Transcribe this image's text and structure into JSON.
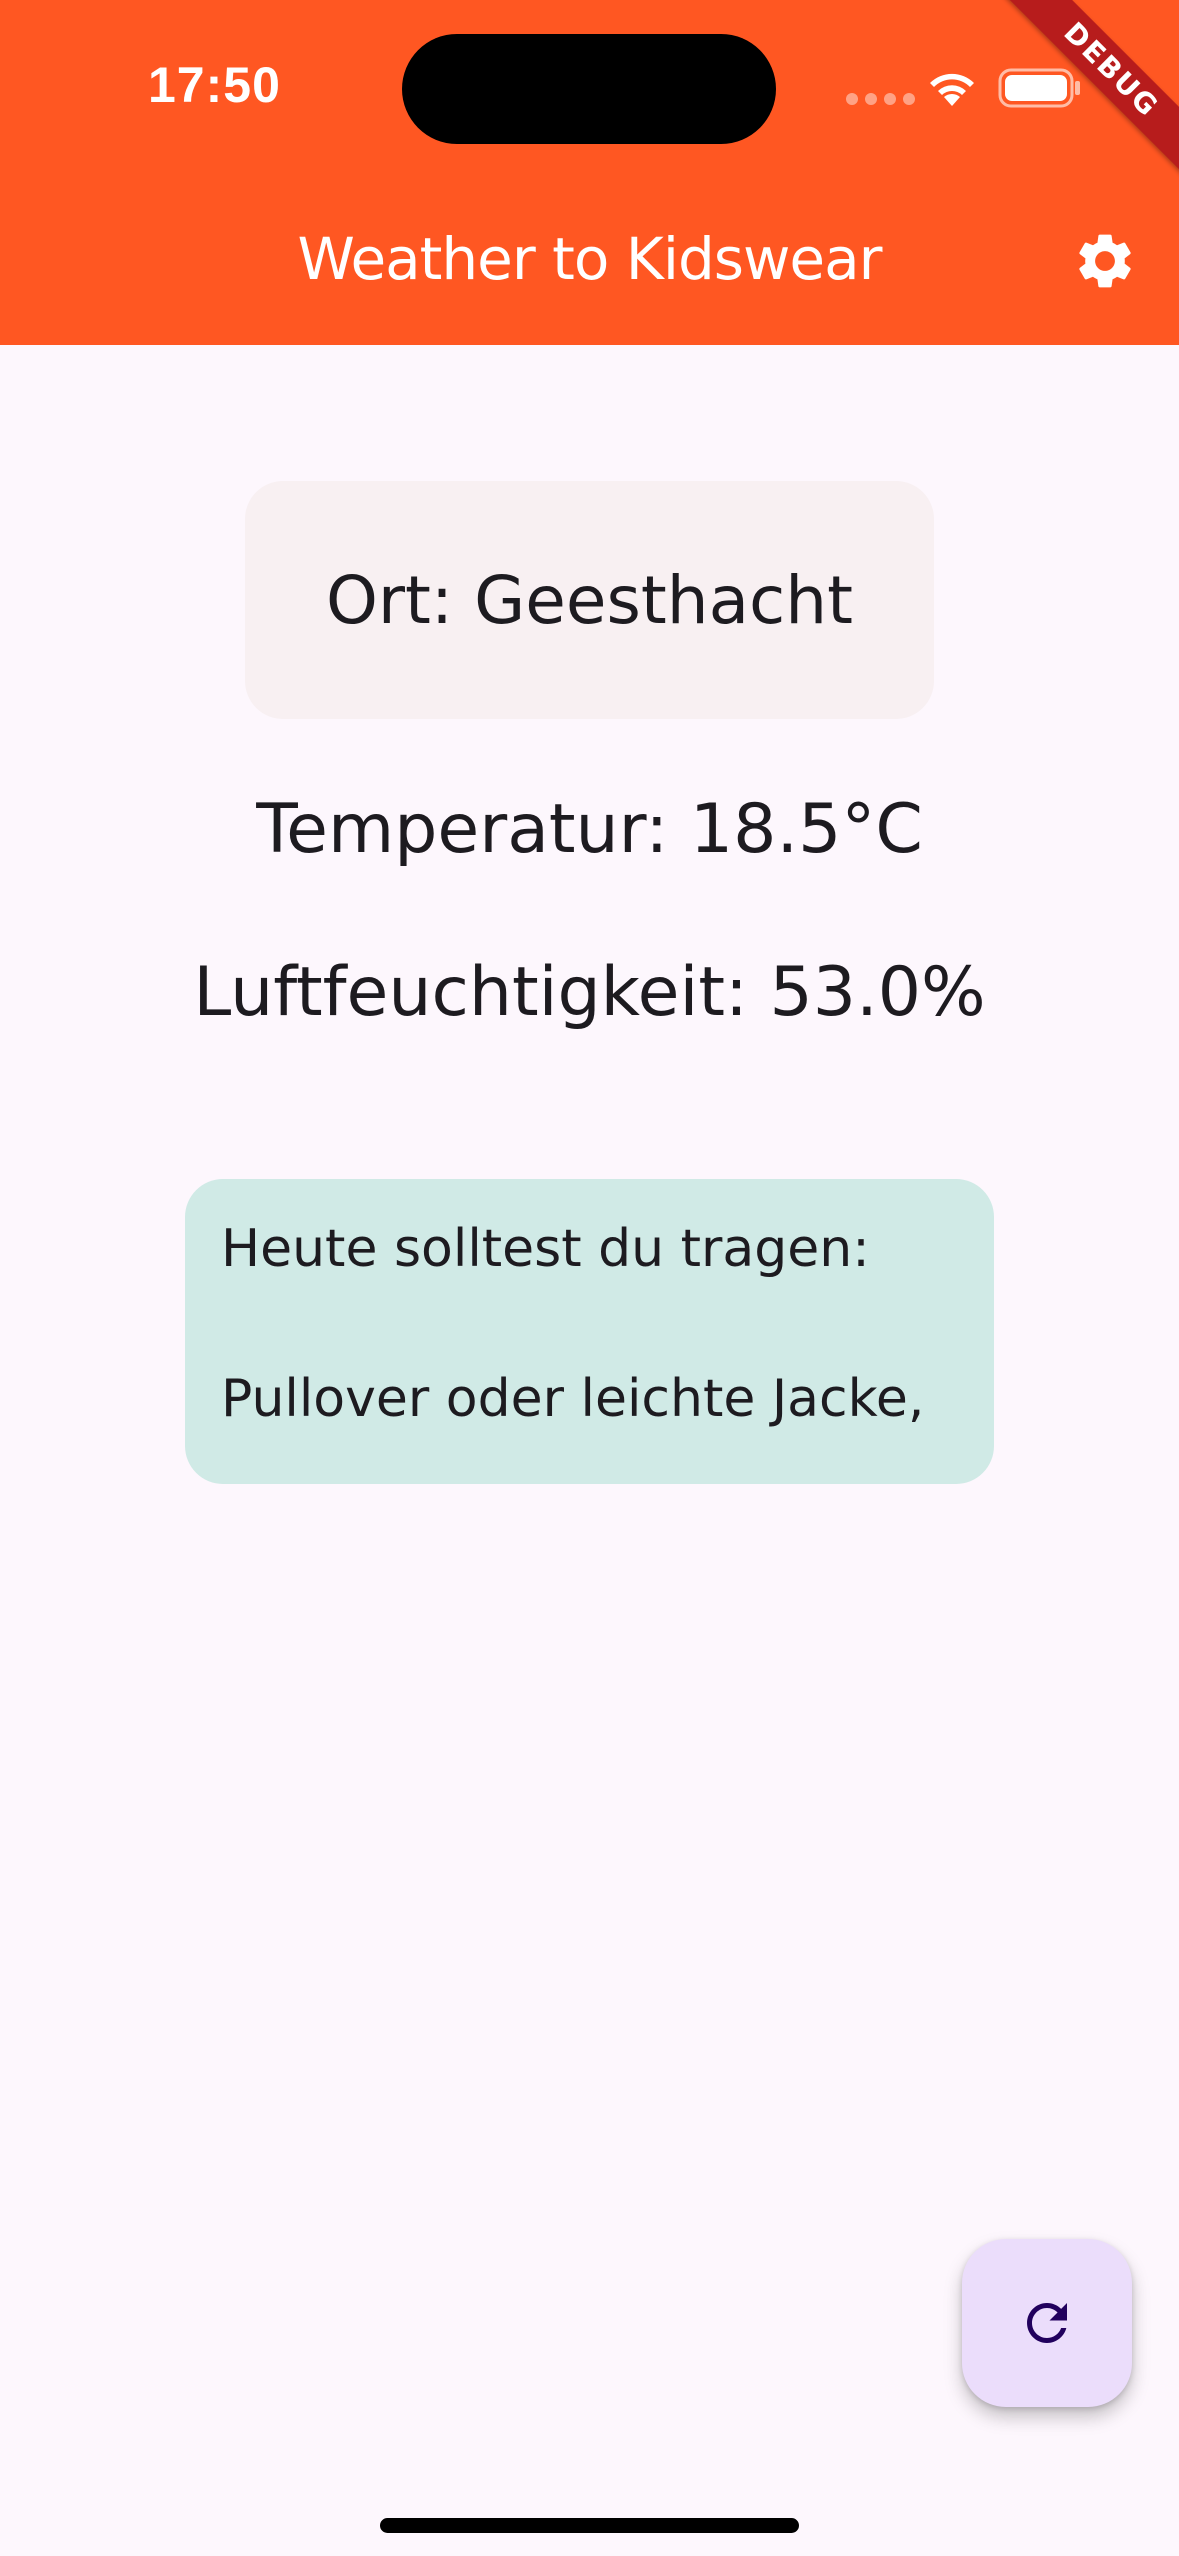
{
  "status_bar": {
    "time": "17:50"
  },
  "debug_banner": {
    "label": "DEBUG"
  },
  "app_bar": {
    "title": "Weather to Kidswear",
    "settings_icon": "gear-icon",
    "background_color": "#ff5722"
  },
  "weather": {
    "location": "Ort: Geesthacht",
    "temperature": "Temperatur: 18.5°C",
    "humidity": "Luftfeuchtigkeit: 53.0%"
  },
  "advice": {
    "heading": "Heute solltest du tragen:",
    "body": "Pullover oder leichte Jacke,",
    "background_color": "#d0eae6"
  },
  "fab": {
    "icon": "refresh-icon",
    "background_color": "#ebddfb"
  }
}
